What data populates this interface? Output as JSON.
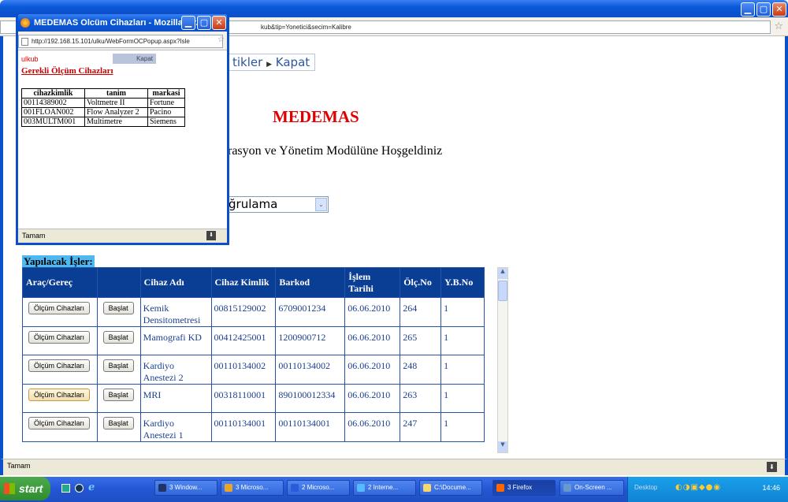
{
  "main_window": {
    "url_fragment": "kub&tip=Yonetici&secim=Kalibre",
    "status": "Tamam"
  },
  "page": {
    "menu_fragment": "tikler",
    "menu_kapat": "Kapat",
    "title": "MEDEMAS",
    "welcome": "rasyon ve Yönetim Modülüne Hoşgeldiniz",
    "select_value": "ğrulama"
  },
  "tasks": {
    "heading": "Yapılacak İşler:",
    "headers": [
      "Araç/Gereç",
      "",
      "Cihaz Adı",
      "Cihaz Kimlik",
      "Barkod",
      "İşlem Tarihi",
      "Ölç.No",
      "Y.B.No"
    ],
    "olcum_label": "Ölçüm Cihazları",
    "baslat_label": "Başlat",
    "rows": [
      {
        "ad": "Kemik Densitometresi",
        "kimlik": "00815129002",
        "barkod": "6709001234",
        "tarih": "06.06.2010",
        "olc": "264",
        "yb": "1"
      },
      {
        "ad": "Mamografi KD",
        "kimlik": "00412425001",
        "barkod": "1200900712",
        "tarih": "06.06.2010",
        "olc": "265",
        "yb": "1"
      },
      {
        "ad": "Kardiyo Anestezi 2",
        "kimlik": "00110134002",
        "barkod": "00110134002",
        "tarih": "06.06.2010",
        "olc": "248",
        "yb": "1"
      },
      {
        "ad": "MRI",
        "kimlik": "00318110001",
        "barkod": "890100012334",
        "tarih": "06.06.2010",
        "olc": "263",
        "yb": "1"
      },
      {
        "ad": "Kardiyo Anestezi 1",
        "kimlik": "00110134001",
        "barkod": "00110134001",
        "tarih": "06.06.2010",
        "olc": "247",
        "yb": "1"
      }
    ]
  },
  "popup": {
    "title": "MEDEMAS Olcüm Cihazları - Mozilla Fir...",
    "url": "http://192.168.15.101/ulku/WebFormOCPopup.aspx?Isle",
    "user": "ulkub",
    "kapat": "Kapat",
    "heading": "Gerekli Ölçüm Cihazları",
    "headers": [
      "cihazkimlik",
      "tanim",
      "markasi"
    ],
    "rows": [
      [
        "00114389002",
        "Voltmetre II",
        "Fortune"
      ],
      [
        "001FLOAN002",
        "Flow Analyzer 2",
        "Pacino"
      ],
      [
        "003MULTM001",
        "Multimetre",
        "Siemens"
      ]
    ],
    "status": "Tamam"
  },
  "taskbar": {
    "start": "start",
    "items": [
      "3 Window...",
      "3 Microso...",
      "2 Microso...",
      "2 Interne...",
      "C:\\Docume...",
      "3 Firefox",
      "On-Screen ..."
    ],
    "desktop": "Desktop",
    "clock": "14:46"
  }
}
